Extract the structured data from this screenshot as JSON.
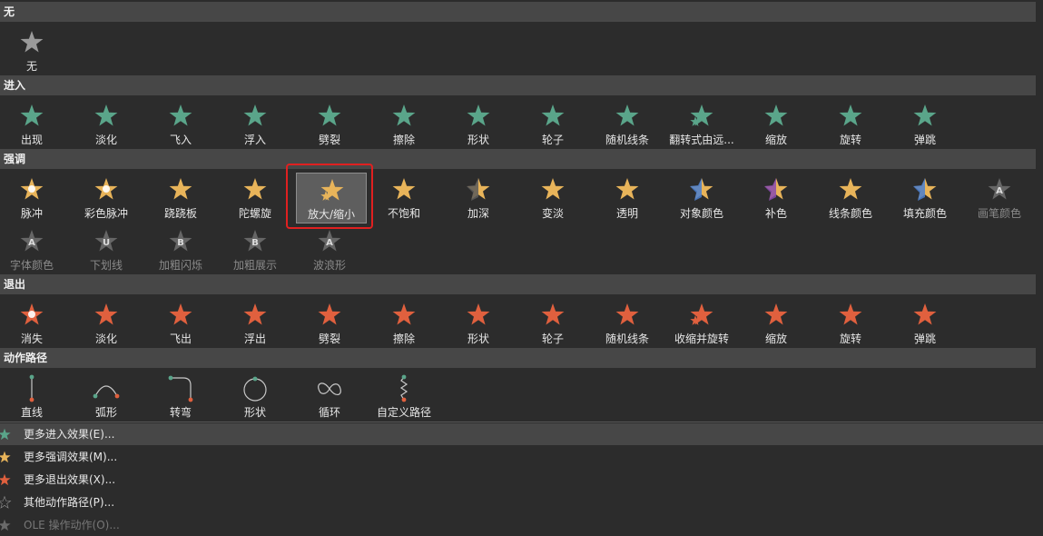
{
  "sections": {
    "none": {
      "title": "无",
      "items": [
        {
          "label": "无",
          "color": "#9a9a9a",
          "icon": "star-gray-icon",
          "name": "effect-none"
        }
      ]
    },
    "entrance": {
      "title": "进入",
      "color": "#5aa58a",
      "items": [
        {
          "label": "出现"
        },
        {
          "label": "淡化"
        },
        {
          "label": "飞入"
        },
        {
          "label": "浮入"
        },
        {
          "label": "劈裂"
        },
        {
          "label": "擦除"
        },
        {
          "label": "形状"
        },
        {
          "label": "轮子"
        },
        {
          "label": "随机线条"
        },
        {
          "label": "翻转式由远..."
        },
        {
          "label": "缩放"
        },
        {
          "label": "旋转"
        },
        {
          "label": "弹跳"
        }
      ]
    },
    "emphasis": {
      "title": "强调",
      "color": "#e8b45a",
      "items": [
        {
          "label": "脉冲"
        },
        {
          "label": "彩色脉冲"
        },
        {
          "label": "跷跷板"
        },
        {
          "label": "陀螺旋"
        },
        {
          "label": "放大/缩小"
        },
        {
          "label": "不饱和"
        },
        {
          "label": "加深"
        },
        {
          "label": "变淡"
        },
        {
          "label": "透明"
        },
        {
          "label": "对象颜色"
        },
        {
          "label": "补色"
        },
        {
          "label": "线条颜色"
        },
        {
          "label": "填充颜色"
        },
        {
          "label": "画笔颜色"
        },
        {
          "label": "字体颜色"
        },
        {
          "label": "下划线"
        },
        {
          "label": "加粗闪烁"
        },
        {
          "label": "加粗展示"
        },
        {
          "label": "波浪形"
        }
      ],
      "selected_label": "放大/缩小"
    },
    "exit": {
      "title": "退出",
      "color": "#e0603e",
      "items": [
        {
          "label": "消失"
        },
        {
          "label": "淡化"
        },
        {
          "label": "飞出"
        },
        {
          "label": "浮出"
        },
        {
          "label": "劈裂"
        },
        {
          "label": "擦除"
        },
        {
          "label": "形状"
        },
        {
          "label": "轮子"
        },
        {
          "label": "随机线条"
        },
        {
          "label": "收缩并旋转"
        },
        {
          "label": "缩放"
        },
        {
          "label": "旋转"
        },
        {
          "label": "弹跳"
        }
      ]
    },
    "paths": {
      "title": "动作路径",
      "items": [
        {
          "label": "直线"
        },
        {
          "label": "弧形"
        },
        {
          "label": "转弯"
        },
        {
          "label": "形状"
        },
        {
          "label": "循环"
        },
        {
          "label": "自定义路径"
        }
      ]
    }
  },
  "menu": [
    {
      "label": "更多进入效果(E)...",
      "color": "#5aa58a",
      "icon": "star-green-icon"
    },
    {
      "label": "更多强调效果(M)...",
      "color": "#e8b45a",
      "icon": "star-gold-icon"
    },
    {
      "label": "更多退出效果(X)...",
      "color": "#e0603e",
      "icon": "star-red-icon"
    },
    {
      "label": "其他动作路径(P)...",
      "color": "#9a9a9a",
      "icon": "star-outline-icon"
    },
    {
      "label": "OLE 操作动作(O)...",
      "color": "#6a6a6a",
      "icon": "gear-icon"
    }
  ]
}
